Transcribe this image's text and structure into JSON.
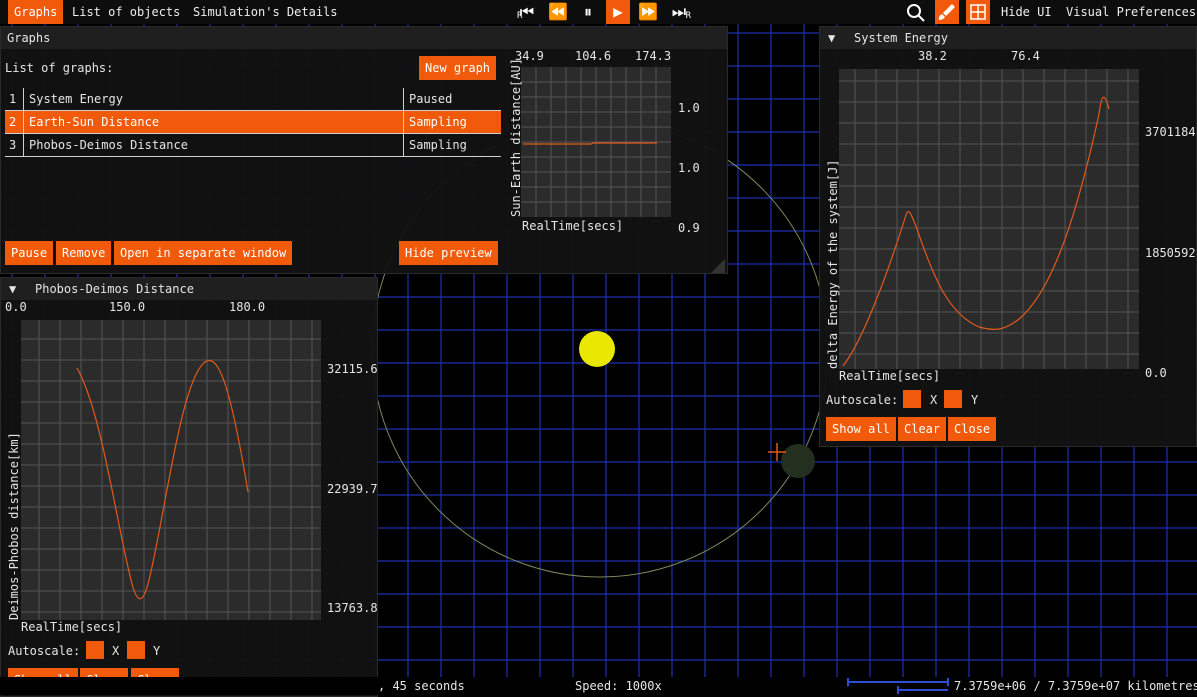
{
  "menubar": {
    "items": [
      "Graphs",
      "List of objects",
      "Simulation's Details"
    ],
    "right_items": [
      "Hide UI",
      "Visual Preferences"
    ],
    "playback": {
      "rewind_r": "R",
      "forward_r": "R"
    }
  },
  "graphs_panel": {
    "title": "Graphs",
    "list_label": "List of graphs:",
    "new_graph": "New graph",
    "rows": [
      {
        "num": "1",
        "name": "System Energy",
        "status": "Paused"
      },
      {
        "num": "2",
        "name": "Earth-Sun Distance",
        "status": "Sampling"
      },
      {
        "num": "3",
        "name": "Phobos-Deimos Distance",
        "status": "Sampling"
      }
    ],
    "buttons": {
      "pause": "Pause",
      "remove": "Remove",
      "open_separate": "Open in separate window",
      "hide_preview": "Hide preview"
    },
    "preview": {
      "top_ticks": [
        "34.9",
        "104.6",
        "174.3"
      ],
      "right_ticks": [
        "1.0",
        "1.0",
        "0.9"
      ],
      "ylabel": "Sun-Earth distance[AU]",
      "xlabel": "RealTime[secs]"
    }
  },
  "phobos_panel": {
    "title": "Phobos-Deimos Distance",
    "top_ticks": [
      "0.0",
      "150.0",
      "180.0"
    ],
    "right_ticks": [
      "32115.6",
      "22939.7",
      "13763.8"
    ],
    "ylabel": "Deimos-Phobos distance[km]",
    "xlabel": "RealTime[secs]",
    "autoscale": "Autoscale:",
    "x": "X",
    "y": "Y",
    "buttons": {
      "show_all": "Show all",
      "clear": "Clear",
      "close": "Close"
    }
  },
  "energy_panel": {
    "title": "System Energy",
    "top_ticks": [
      "38.2",
      "76.4"
    ],
    "right_ticks": [
      "3701184",
      "1850592",
      "0.0"
    ],
    "ylabel": "delta Energy of the system[J]",
    "xlabel": "RealTime[secs]",
    "autoscale": "Autoscale:",
    "x": "X",
    "y": "Y",
    "buttons": {
      "show_all": "Show all",
      "clear": "Clear",
      "close": "Close"
    }
  },
  "statusbar": {
    "time": ", 45 seconds",
    "speed": "Speed: 1000x",
    "scale": "7.3759e+06 / 7.3759e+07 kilometres"
  },
  "colors": {
    "accent": "#f05a0a",
    "grid": "#1f2fb0",
    "sun": "#e8e800",
    "trace": "#e05a1a"
  }
}
